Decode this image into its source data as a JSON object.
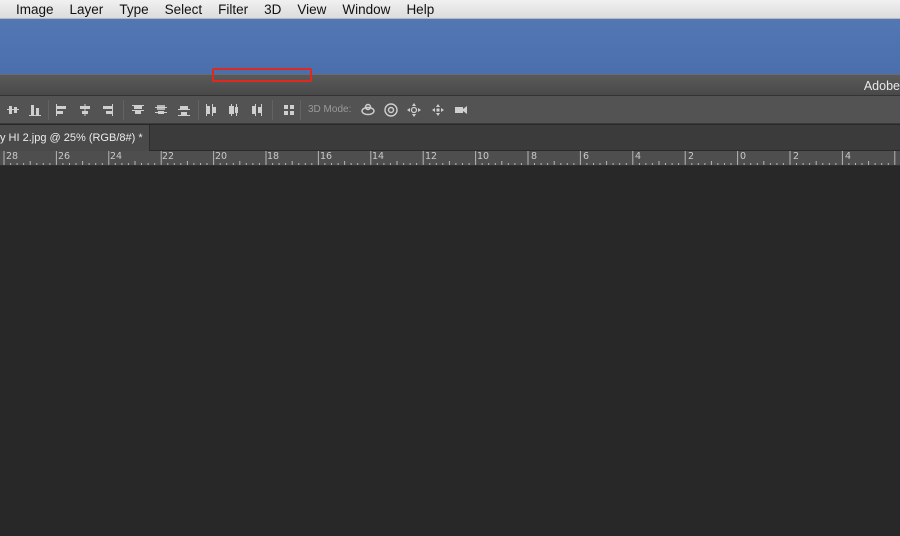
{
  "menubar": {
    "items": [
      {
        "id": "image",
        "label": "Image"
      },
      {
        "id": "layer",
        "label": "Layer"
      },
      {
        "id": "type",
        "label": "Type"
      },
      {
        "id": "select",
        "label": "Select"
      },
      {
        "id": "filter",
        "label": "Filter"
      },
      {
        "id": "3d",
        "label": "3D"
      },
      {
        "id": "view",
        "label": "View"
      },
      {
        "id": "window",
        "label": "Window"
      },
      {
        "id": "help",
        "label": "Help"
      }
    ]
  },
  "app_titlebar": {
    "title": "Adobe"
  },
  "options_bar": {
    "mode_label": "3D Mode:",
    "icons": [
      "distribute-horizontal-center-icon",
      "align-bottom-edges-icon",
      "align-left-edges-icon",
      "align-horizontal-centers-icon",
      "align-right-edges-icon",
      "distribute-top-edges-icon",
      "distribute-vertical-centers-icon",
      "distribute-bottom-edges-icon",
      "distribute-left-edges-icon",
      "distribute-horizontal-centers-icon",
      "distribute-right-edges-icon",
      "auto-align-layers-icon",
      "rotate-3d-icon",
      "roll-3d-icon",
      "drag-3d-icon",
      "slide-3d-icon",
      "scale-3d-camera-icon"
    ]
  },
  "document_tab": {
    "title": "y HI 2.jpg @ 25% (RGB/8#) *"
  },
  "ruler": {
    "labels": [
      "28",
      "26",
      "24",
      "22",
      "20",
      "18",
      "16",
      "14",
      "12",
      "10",
      "8",
      "6",
      "4",
      "2",
      "0",
      "2",
      "4"
    ]
  },
  "colors": {
    "menubar_bg": "#e6e6e6",
    "desktop_blue": "#4f74b0",
    "highlight_red": "#e0281e",
    "canvas_bg": "#282828",
    "panel_bg": "#535353"
  }
}
